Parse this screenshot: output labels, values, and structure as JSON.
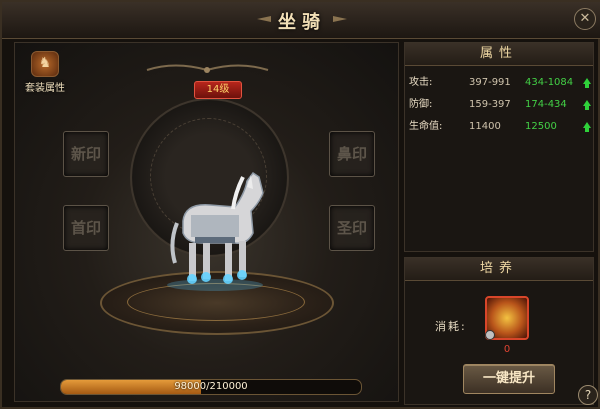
{
  "window": {
    "title": "坐骑",
    "close_icon": "close-icon"
  },
  "stage": {
    "set_attribute_label": "套装属性",
    "set_attribute_icon": "horse-head-icon",
    "level_badge": "14级",
    "slots": [
      {
        "id": "seal-1",
        "label": "新印"
      },
      {
        "id": "seal-2",
        "label": "鼻印"
      },
      {
        "id": "seal-3",
        "label": "首印"
      },
      {
        "id": "seal-4",
        "label": "圣印"
      }
    ],
    "exp": {
      "current": 98000,
      "max": 210000,
      "text": "98000/210000"
    }
  },
  "attributes": {
    "header": "属性",
    "rows": [
      {
        "label": "攻击:",
        "current": "397-991",
        "next": "434-1084"
      },
      {
        "label": "防御:",
        "current": "159-397",
        "next": "174-434"
      },
      {
        "label": "生命值:",
        "current": "11400",
        "next": "12500"
      }
    ],
    "up_arrow_icon": "green-up-arrow-icon"
  },
  "training": {
    "header": "培养",
    "cost_label": "消耗:",
    "cost_item_icon": "golden-saddle-icon",
    "cost_count": "0",
    "upgrade_button": "一键提升"
  },
  "help": {
    "label": "?"
  },
  "colors": {
    "accent": "#f0d9a4",
    "green": "#43d046",
    "red": "#e04432",
    "panel": "#1a1612"
  }
}
